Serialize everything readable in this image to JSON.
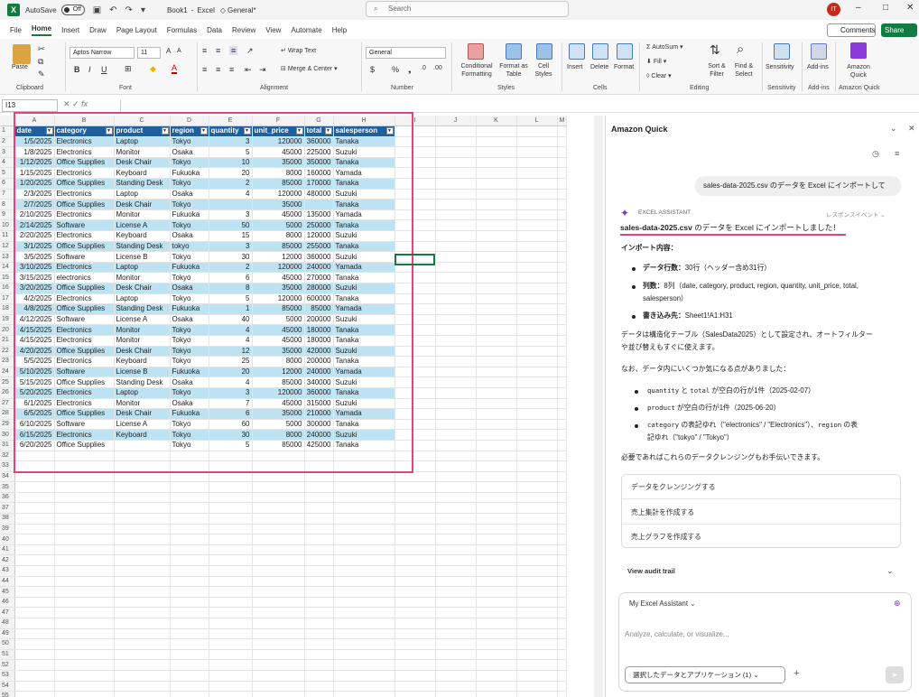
{
  "titlebar": {
    "autosave_label": "AutoSave",
    "autosave_state": "Off",
    "file_name": "Book1",
    "app_name": "Excel",
    "sensitivity": "General*",
    "search_placeholder": "Search",
    "user_initials": "IT"
  },
  "menu": {
    "tabs": [
      "File",
      "Home",
      "Insert",
      "Draw",
      "Page Layout",
      "Formulas",
      "Data",
      "Review",
      "View",
      "Automate",
      "Help"
    ],
    "active": "Home",
    "comments": "Comments",
    "share": "Share"
  },
  "ribbon": {
    "groups": {
      "clipboard": "Clipboard",
      "font": "Font",
      "alignment": "Alignment",
      "number": "Number",
      "styles": "Styles",
      "cells": "Cells",
      "editing": "Editing",
      "sensitivity": "Sensitivity",
      "addins": "Add-ins",
      "amazonquick": "Amazon Quick"
    },
    "paste": "Paste",
    "font_name": "Aptos Narrow",
    "font_size": "11",
    "wrap_text": "Wrap Text",
    "merge_center": "Merge & Center",
    "number_format": "General",
    "cond_format": "Conditional Formatting",
    "format_table": "Format as Table",
    "cell_styles": "Cell Styles",
    "insert": "Insert",
    "delete": "Delete",
    "format": "Format",
    "autosum": "AutoSum",
    "fill": "Fill",
    "clear": "Clear",
    "sort_filter": "Sort & Filter",
    "find_select": "Find & Select",
    "sensitivity_btn": "Sensitivity",
    "addins_btn": "Add-ins",
    "amazon_quick_btn": "Amazon Quick"
  },
  "formula_bar": {
    "name_box": "I13",
    "fx": "fx"
  },
  "sheet": {
    "columns": [
      "A",
      "B",
      "C",
      "D",
      "E",
      "F",
      "G",
      "H",
      "I",
      "J",
      "K",
      "L",
      "M"
    ],
    "headers": [
      "date",
      "category",
      "product",
      "region",
      "quantity",
      "unit_price",
      "total",
      "salesperson"
    ],
    "rows": [
      [
        "1/5/2025",
        "Electronics",
        "Laptop",
        "Tokyo",
        "3",
        "120000",
        "360000",
        "Tanaka"
      ],
      [
        "1/8/2025",
        "Electronics",
        "Monitor",
        "Osaka",
        "5",
        "45000",
        "225000",
        "Suzuki"
      ],
      [
        "1/12/2025",
        "Office Supplies",
        "Desk Chair",
        "Tokyo",
        "10",
        "35000",
        "350000",
        "Tanaka"
      ],
      [
        "1/15/2025",
        "Electronics",
        "Keyboard",
        "Fukuoka",
        "20",
        "8000",
        "160000",
        "Yamada"
      ],
      [
        "1/20/2025",
        "Office Supplies",
        "Standing Desk",
        "Tokyo",
        "2",
        "85000",
        "170000",
        "Tanaka"
      ],
      [
        "2/3/2025",
        "Electronics",
        "Laptop",
        "Osaka",
        "4",
        "120000",
        "480000",
        "Suzuki"
      ],
      [
        "2/7/2025",
        "Office Supplies",
        "Desk Chair",
        "Tokyo",
        "",
        "35000",
        "",
        "Tanaka"
      ],
      [
        "2/10/2025",
        "Electronics",
        "Monitor",
        "Fukuoka",
        "3",
        "45000",
        "135000",
        "Yamada"
      ],
      [
        "2/14/2025",
        "Software",
        "License A",
        "Tokyo",
        "50",
        "5000",
        "250000",
        "Tanaka"
      ],
      [
        "2/20/2025",
        "Electronics",
        "Keyboard",
        "Osaka",
        "15",
        "8000",
        "120000",
        "Suzuki"
      ],
      [
        "3/1/2025",
        "Office Supplies",
        "Standing Desk",
        "tokyo",
        "3",
        "85000",
        "255000",
        "Tanaka"
      ],
      [
        "3/5/2025",
        "Software",
        "License B",
        "Tokyo",
        "30",
        "12000",
        "360000",
        "Suzuki"
      ],
      [
        "3/10/2025",
        "Electronics",
        "Laptop",
        "Fukuoka",
        "2",
        "120000",
        "240000",
        "Yamada"
      ],
      [
        "3/15/2025",
        "electronics",
        "Monitor",
        "Tokyo",
        "6",
        "45000",
        "270000",
        "Tanaka"
      ],
      [
        "3/20/2025",
        "Office Supplies",
        "Desk Chair",
        "Osaka",
        "8",
        "35000",
        "280000",
        "Suzuki"
      ],
      [
        "4/2/2025",
        "Electronics",
        "Laptop",
        "Tokyo",
        "5",
        "120000",
        "600000",
        "Tanaka"
      ],
      [
        "4/8/2025",
        "Office Supplies",
        "Standing Desk",
        "Fukuoka",
        "1",
        "85000",
        "85000",
        "Yamada"
      ],
      [
        "4/12/2025",
        "Software",
        "License A",
        "Osaka",
        "40",
        "5000",
        "200000",
        "Suzuki"
      ],
      [
        "4/15/2025",
        "Electronics",
        "Monitor",
        "Tokyo",
        "4",
        "45000",
        "180000",
        "Tanaka"
      ],
      [
        "4/15/2025",
        "Electronics",
        "Monitor",
        "Tokyo",
        "4",
        "45000",
        "180000",
        "Tanaka"
      ],
      [
        "4/20/2025",
        "Office Supplies",
        "Desk Chair",
        "Tokyo",
        "12",
        "35000",
        "420000",
        "Suzuki"
      ],
      [
        "5/5/2025",
        "Electronics",
        "Keyboard",
        "Tokyo",
        "25",
        "8000",
        "200000",
        "Tanaka"
      ],
      [
        "5/10/2025",
        "Software",
        "License B",
        "Fukuoka",
        "20",
        "12000",
        "240000",
        "Yamada"
      ],
      [
        "5/15/2025",
        "Office Supplies",
        "Standing Desk",
        "Osaka",
        "4",
        "85000",
        "340000",
        "Suzuki"
      ],
      [
        "5/20/2025",
        "Electronics",
        "Laptop",
        "Tokyo",
        "3",
        "120000",
        "360000",
        "Tanaka"
      ],
      [
        "6/1/2025",
        "Electronics",
        "Monitor",
        "Osaka",
        "7",
        "45000",
        "315000",
        "Suzuki"
      ],
      [
        "6/5/2025",
        "Office Supplies",
        "Desk Chair",
        "Fukuoka",
        "6",
        "35000",
        "210000",
        "Yamada"
      ],
      [
        "6/10/2025",
        "Software",
        "License A",
        "Tokyo",
        "60",
        "5000",
        "300000",
        "Tanaka"
      ],
      [
        "6/15/2025",
        "Electronics",
        "Keyboard",
        "Tokyo",
        "30",
        "8000",
        "240000",
        "Suzuki"
      ],
      [
        "6/20/2025",
        "Office Supplies",
        "",
        "Tokyo",
        "5",
        "85000",
        "425000",
        "Tanaka"
      ]
    ],
    "total_rows": 55,
    "active_cell": "I13",
    "table_header_color": "#1f5f9e",
    "band_color": "#bde3f3",
    "highlight_color": "#e0457b"
  },
  "pane": {
    "title": "Amazon Quick",
    "user_message": "sales-data-2025.csv のデータを Excel にインポートして",
    "assistant_label": "EXCEL ASSISTANT",
    "response_event": "レスポンスイベント",
    "heading_file": "sales-data-2025.csv",
    "heading_rest": " のデータを Excel にインポートしました！",
    "import_title": "インポート内容：",
    "bullets": [
      {
        "label": "データ行数：",
        "text": "30行（ヘッダー含め31行）"
      },
      {
        "label": "列数：",
        "text": "8列（date, category, product, region, quantity, unit_price, total,"
      },
      {
        "label": "",
        "text": "salesperson）"
      },
      {
        "label": "書き込み先：",
        "text": "Sheet1!A1:H31"
      }
    ],
    "para1_line1": "データは構造化テーブル（SalesData2025）として設定され、オートフィルター",
    "para1_line2": "や並び替えもすぐに使えます。",
    "para2": "なお、データ内にいくつか気になる点がありました：",
    "notes": [
      {
        "c1": "quantity",
        "t1": " と ",
        "c2": "total",
        "t2": " が空白の行が1件（2025-02-07）"
      },
      {
        "c1": "product",
        "t1": " が空白の行が1件（2025-06-20）",
        "c2": "",
        "t2": ""
      },
      {
        "c1": "category",
        "t1": " の表記ゆれ（\"electronics\" / \"Electronics\"）、",
        "c2": "region",
        "t2": " の表"
      },
      {
        "c1": "",
        "t1": "記ゆれ（\"tokyo\" / \"Tokyo\"）",
        "c2": "",
        "t2": ""
      }
    ],
    "para3": "必要であればこれらのデータクレンジングもお手伝いできます。",
    "actions": [
      "データをクレンジングする",
      "売上集計を作成する",
      "売上グラフを作成する"
    ],
    "audit": "View audit trail",
    "composer_select": "My Excel Assistant",
    "composer_placeholder": "Analyze, calculate, or visualize...",
    "context_button": "選択したデータとアプリケーション (1)"
  }
}
